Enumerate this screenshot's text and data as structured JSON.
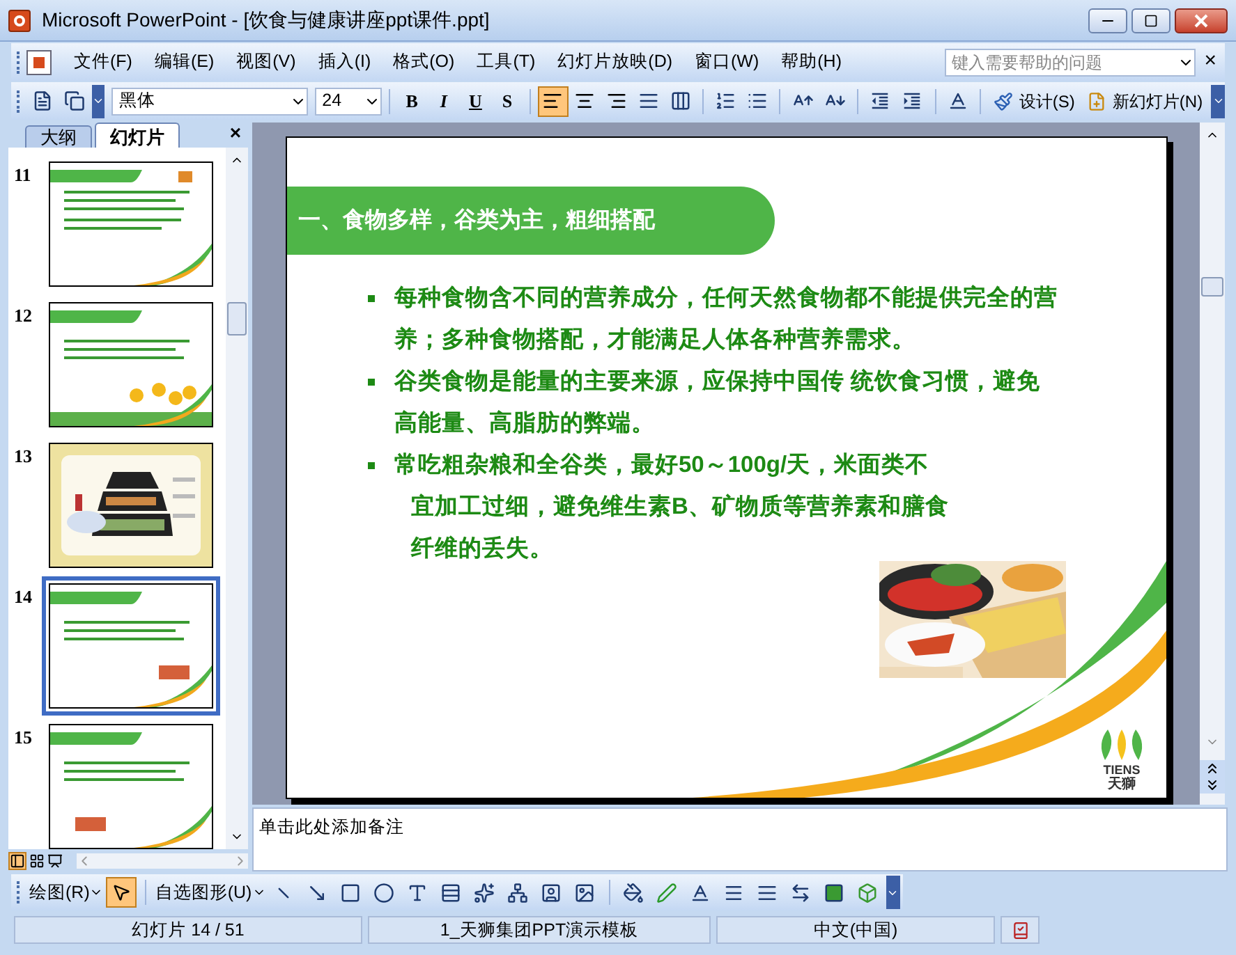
{
  "window": {
    "title": "Microsoft PowerPoint - [饮食与健康讲座ppt课件.ppt]"
  },
  "menu": [
    "文件(F)",
    "编辑(E)",
    "视图(V)",
    "插入(I)",
    "格式(O)",
    "工具(T)",
    "幻灯片放映(D)",
    "窗口(W)",
    "帮助(H)"
  ],
  "help_box": {
    "placeholder": "键入需要帮助的问题"
  },
  "menu_close": "×",
  "formatting_toolbar": {
    "font": "黑体",
    "size": "24",
    "style_buttons": [
      "B",
      "I",
      "U",
      "S"
    ],
    "align": [
      {
        "kind": "left",
        "selected": true
      },
      {
        "kind": "center",
        "selected": false
      },
      {
        "kind": "right",
        "selected": false
      }
    ],
    "design_button": "设计(S)",
    "new_slide_button": "新幻灯片(N)"
  },
  "pane_tabs": [
    {
      "label": "大纲",
      "selected": false
    },
    {
      "label": "幻灯片",
      "selected": true
    }
  ],
  "pane_close": "×",
  "thumbnails": [
    {
      "number": "11",
      "kind": "text",
      "selected": false
    },
    {
      "number": "12",
      "kind": "flowers",
      "selected": false
    },
    {
      "number": "13",
      "kind": "pyramid",
      "selected": false
    },
    {
      "number": "14",
      "selected": true
    },
    {
      "number": "15",
      "selected": false
    }
  ],
  "slide": {
    "title": "一、食物多样，谷类为主，粗细搭配",
    "bullets": [
      {
        "lines": [
          "每种食物含不同的营养成分，任何天然食物都不能提供完全的营",
          "养；多种食物搭配，才能满足人体各种营养需求。"
        ]
      },
      {
        "lines": [
          "谷类食物是能量的主要来源，应保持中国传 统饮食习惯，避免",
          "高能量、高脂肪的弊端。"
        ]
      },
      {
        "lines": [
          "常吃粗杂粮和全谷类，最好50～100g/天，米面类不",
          "宜加工过细，避免维生素B、矿物质等营养素和膳食",
          "纤维的丢失。"
        ]
      }
    ],
    "logo": {
      "name": "TIENS",
      "subtitle": "天獅"
    }
  },
  "notes": {
    "text": "单击此处添加备注"
  },
  "drawing_toolbar": {
    "draw_menu": "绘图(R)",
    "autoshapes_menu": "自选图形(U)",
    "pointer_selected": true
  },
  "status_bar": [
    "幻灯片 14 / 51",
    "1_天狮集团PPT演示模板",
    "中文(中国)"
  ]
}
